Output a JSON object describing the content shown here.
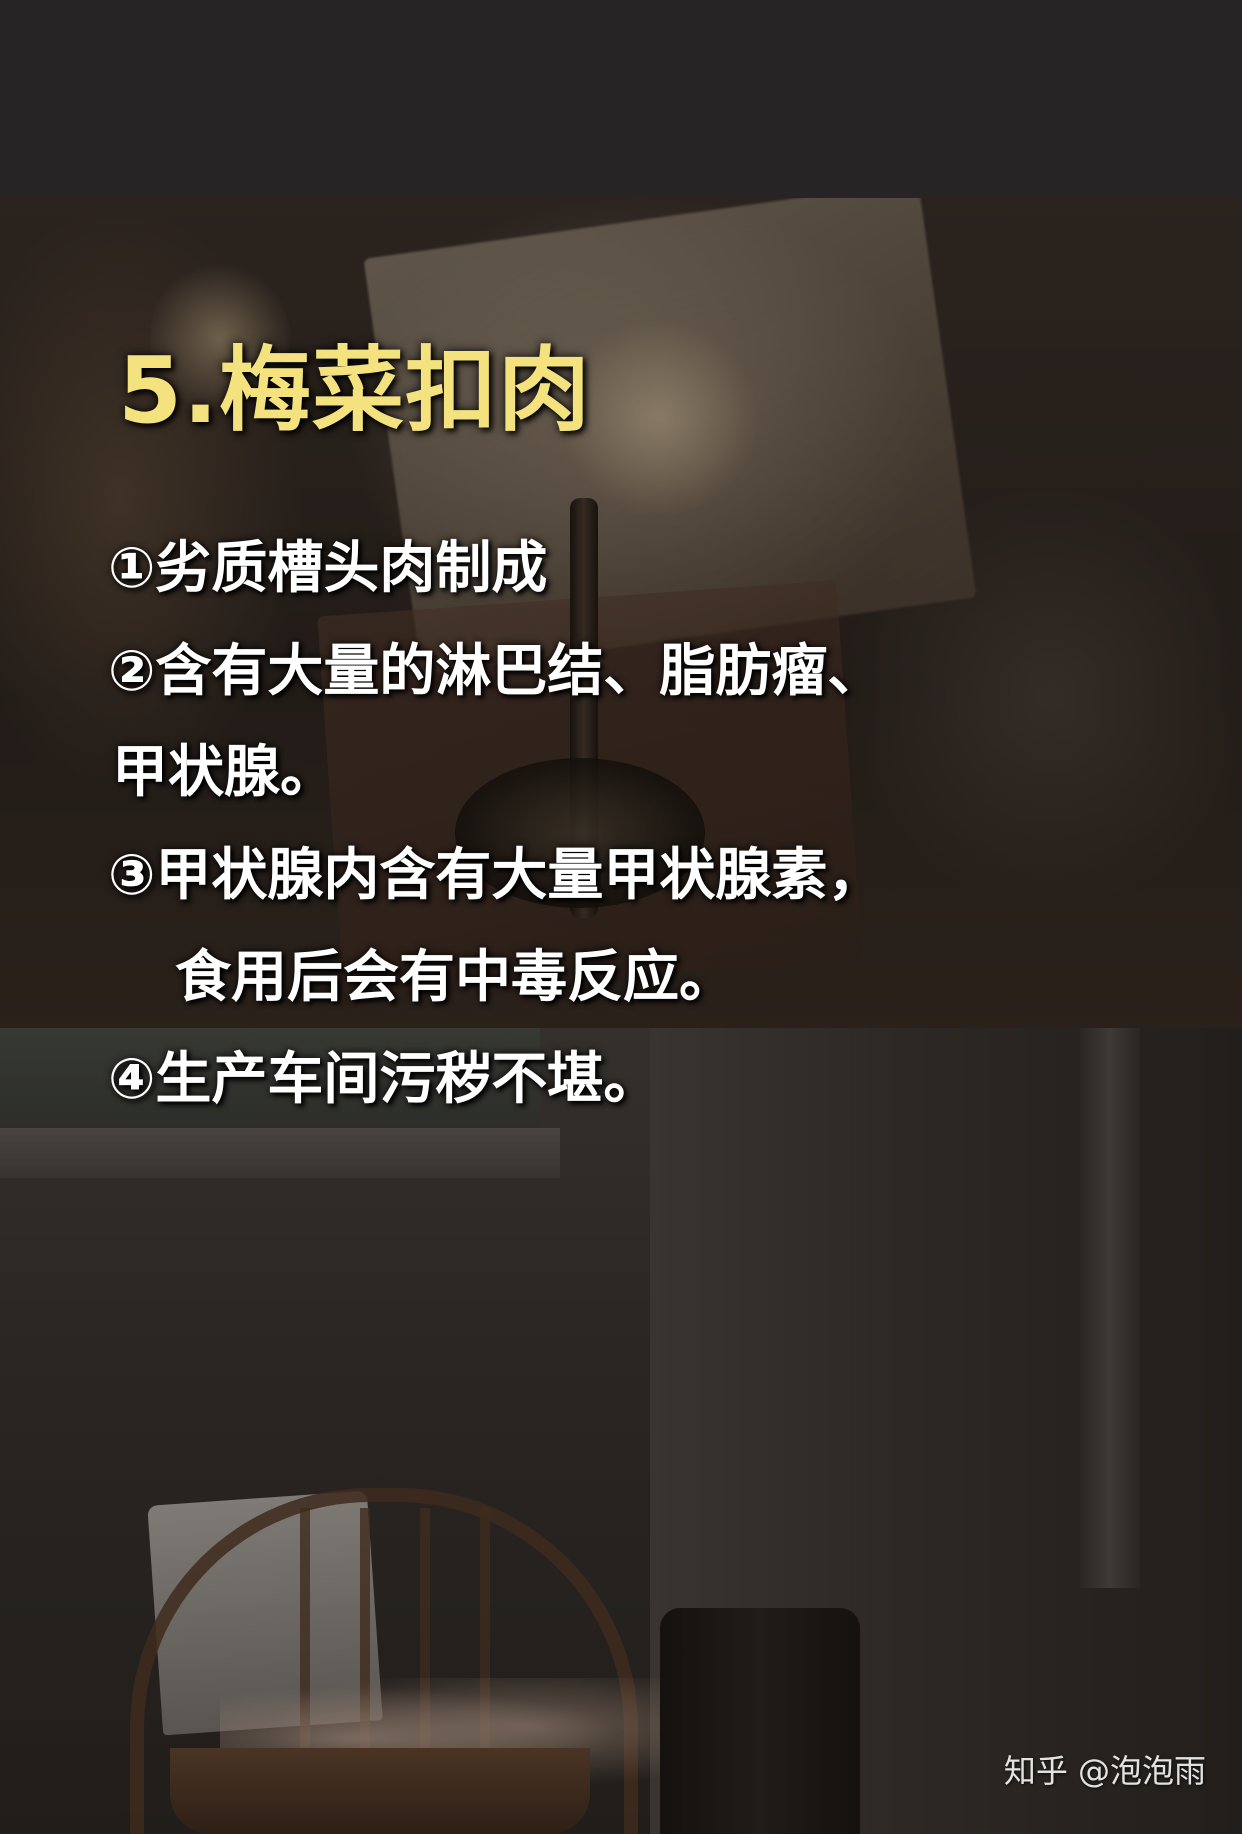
{
  "title": "5.梅菜扣肉",
  "points": [
    "①劣质槽头肉制成",
    "②含有大量的淋巴结、脂肪瘤、",
    "甲状腺。",
    "③甲状腺内含有大量甲状腺素，",
    "食用后会有中毒反应。",
    "④生产车间污秽不堪。"
  ],
  "watermark": "知乎 @泡泡雨",
  "colors": {
    "title": "#f3e27e",
    "text": "#ffffff",
    "top_band": "#262424"
  }
}
